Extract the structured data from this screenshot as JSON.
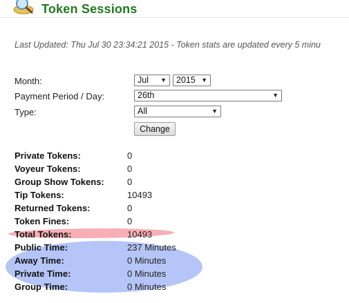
{
  "header": {
    "title": "Token Sessions",
    "title_color": "#1f7a1f",
    "icon": "magnifier-coins-icon"
  },
  "last_updated": "Last Updated: Thu Jul 30 23:34:21 2015 - Token stats are updated every 5 minu",
  "form": {
    "month_label": "Month:",
    "month_value": "Jul",
    "year_value": "2015",
    "period_label": "Payment Period / Day:",
    "period_value": "26th",
    "type_label": "Type:",
    "type_value": "All",
    "change_button": "Change"
  },
  "stats": [
    {
      "label": "Private Tokens:",
      "value": "0"
    },
    {
      "label": "Voyeur Tokens:",
      "value": "0"
    },
    {
      "label": "Group Show Tokens:",
      "value": "0"
    },
    {
      "label": "Tip Tokens:",
      "value": "10493"
    },
    {
      "label": "Returned Tokens:",
      "value": "0"
    },
    {
      "label": "Token Fines:",
      "value": "0"
    },
    {
      "label": "Total Tokens:",
      "value": "10493"
    },
    {
      "label": "Public Time:",
      "value": "237 Minutes"
    },
    {
      "label": "Away Time:",
      "value": "0 Minutes"
    },
    {
      "label": "Private Time:",
      "value": "0 Minutes"
    },
    {
      "label": "Group Time:",
      "value": "0 Minutes"
    }
  ],
  "annotations": {
    "total_highlight_color": "#f06e78",
    "time_highlight_color": "#7896f0"
  }
}
